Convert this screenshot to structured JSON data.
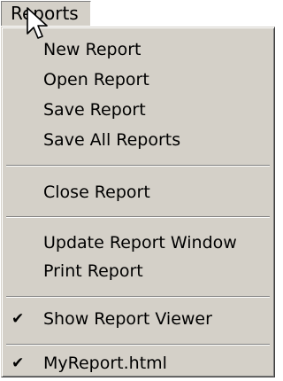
{
  "menubar": {
    "title": "Reports"
  },
  "menu": {
    "items": [
      {
        "label": "New Report",
        "checked": false
      },
      {
        "label": "Open Report",
        "checked": false
      },
      {
        "label": "Save Report",
        "checked": false
      },
      {
        "label": "Save All Reports",
        "checked": false
      },
      {
        "label": "Close Report",
        "checked": false
      },
      {
        "label": "Update Report Window",
        "checked": false
      },
      {
        "label": "Print Report",
        "checked": false
      },
      {
        "label": "Show Report Viewer",
        "checked": true
      },
      {
        "label": "MyReport.html",
        "checked": true
      }
    ],
    "check_glyph": "✔"
  },
  "colors": {
    "menu_background": "#d4d0c8",
    "text": "#000000"
  }
}
